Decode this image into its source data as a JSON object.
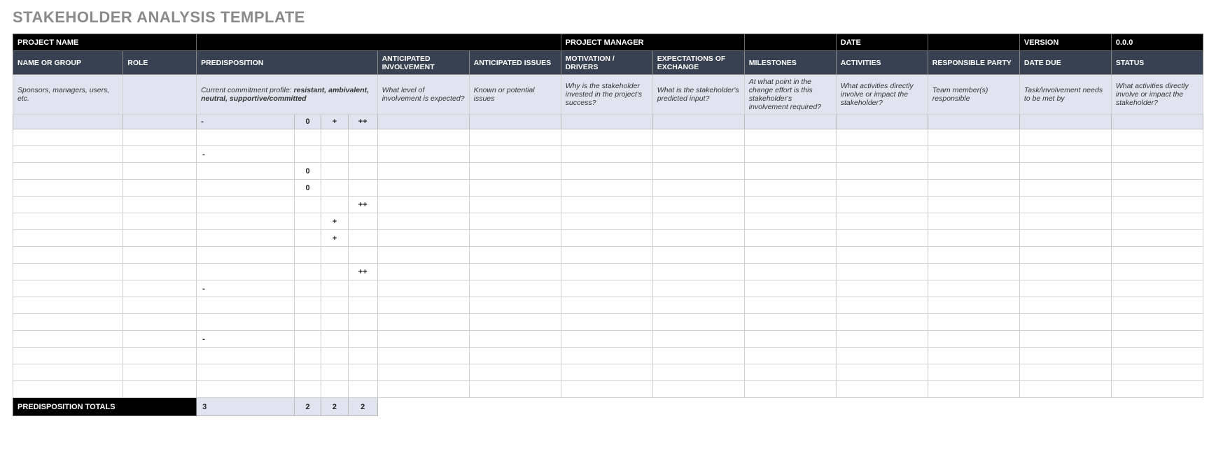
{
  "page_title": "STAKEHOLDER ANALYSIS TEMPLATE",
  "project_labels": {
    "name": "PROJECT NAME",
    "manager": "PROJECT MANAGER",
    "date": "DATE",
    "version": "VERSION"
  },
  "project_values": {
    "name": "",
    "manager": "",
    "date": "",
    "version": "0.0.0"
  },
  "columns": {
    "name_or_group": "NAME OR GROUP",
    "role": "ROLE",
    "predisposition": "PREDISPOSITION",
    "anticipated_involvement": "ANTICIPATED INVOLVEMENT",
    "anticipated_issues": "ANTICIPATED ISSUES",
    "motivation_drivers": "MOTIVATION / DRIVERS",
    "expectations_of_exchange": "EXPECTATIONS OF EXCHANGE",
    "milestones": "MILESTONES",
    "activities": "ACTIVITIES",
    "responsible_party": "RESPONSIBLE PARTY",
    "date_due": "DATE DUE",
    "status": "STATUS"
  },
  "descriptions": {
    "name_or_group": "Sponsors, managers, users, etc.",
    "role": "",
    "predisposition_pre": "Current commitment profile:  ",
    "predisposition_bold": "resistant, ambivalent, neutral, supportive/committed",
    "anticipated_involvement": "What level of involvement is expected?",
    "anticipated_issues": "Known or potential issues",
    "motivation_drivers": "Why is the stakeholder invested in the project's success?",
    "expectations_of_exchange": "What is the stakeholder's predicted input?",
    "milestones": "At what point in the change effort is this stakeholder's involvement required?",
    "activities": "What activities directly involve or impact the stakeholder?",
    "responsible_party": "Team member(s) responsible",
    "date_due": "Task/involvement needs to be met by",
    "status": "What activities directly involve or impact the stakeholder?"
  },
  "predisposition_symbols": [
    "-",
    "0",
    "+",
    "++"
  ],
  "rows": [
    {
      "pre": [
        "",
        "",
        "",
        ""
      ]
    },
    {
      "pre": [
        "-",
        "",
        "",
        ""
      ]
    },
    {
      "pre": [
        "",
        "0",
        "",
        ""
      ]
    },
    {
      "pre": [
        "",
        "0",
        "",
        ""
      ]
    },
    {
      "pre": [
        "",
        "",
        "",
        "++"
      ]
    },
    {
      "pre": [
        "",
        "",
        "+",
        ""
      ]
    },
    {
      "pre": [
        "",
        "",
        "+",
        ""
      ]
    },
    {
      "pre": [
        "",
        "",
        "",
        ""
      ]
    },
    {
      "pre": [
        "",
        "",
        "",
        "++"
      ]
    },
    {
      "pre": [
        "-",
        "",
        "",
        ""
      ]
    },
    {
      "pre": [
        "",
        "",
        "",
        ""
      ]
    },
    {
      "pre": [
        "",
        "",
        "",
        ""
      ]
    },
    {
      "pre": [
        "-",
        "",
        "",
        ""
      ]
    },
    {
      "pre": [
        "",
        "",
        "",
        ""
      ]
    },
    {
      "pre": [
        "",
        "",
        "",
        ""
      ]
    },
    {
      "pre": [
        "",
        "",
        "",
        ""
      ]
    }
  ],
  "totals": {
    "label": "PREDISPOSITION TOTALS",
    "values": [
      "3",
      "2",
      "2",
      "2"
    ]
  }
}
